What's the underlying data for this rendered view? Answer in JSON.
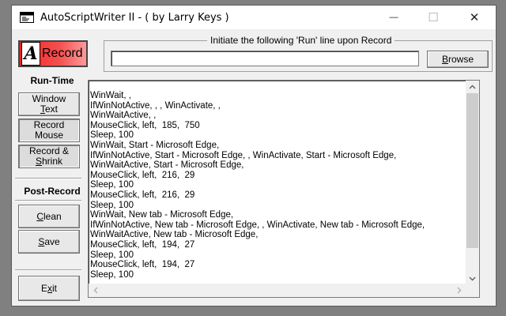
{
  "window": {
    "title": "AutoScriptWriter II - ( by Larry Keys )",
    "minimize_symbol": "—",
    "maximize_symbol": "☐",
    "close_symbol": "✕"
  },
  "record_button": {
    "icon_letter": "A",
    "label": "Record"
  },
  "run_group": {
    "legend": "Initiate the following 'Run' line upon Record",
    "input_value": "",
    "browse_label_first": "B",
    "browse_label_rest": "rowse"
  },
  "sidebar": {
    "runtime_label": "Run-Time",
    "window_text": {
      "line1": "Window",
      "line2_first": "T",
      "line2_rest": "ext"
    },
    "record_mouse": {
      "line1": "Record",
      "line2": "Mouse"
    },
    "record_shrink": {
      "line1": "Record &",
      "line2_first": "S",
      "line2_rest": "hrink"
    },
    "postrecord_label": "Post-Record",
    "clean": {
      "first": "C",
      "rest": "lean"
    },
    "save": {
      "first": "S",
      "rest": "ave"
    },
    "exit": {
      "first": "E",
      "mid": "x",
      "rest": "it"
    }
  },
  "script_text": "WinWait, ,\nIfWinNotActive, , , WinActivate, ,\nWinWaitActive, ,\nMouseClick, left,  185,  750\nSleep, 100\nWinWait, Start - Microsoft Edge,\nIfWinNotActive, Start - Microsoft Edge, , WinActivate, Start - Microsoft Edge,\nWinWaitActive, Start - Microsoft Edge,\nMouseClick, left,  216,  29\nSleep, 100\nMouseClick, left,  216,  29\nSleep, 100\nWinWait, New tab - Microsoft Edge,\nIfWinNotActive, New tab - Microsoft Edge, , WinActivate, New tab - Microsoft Edge,\nWinWaitActive, New tab - Microsoft Edge,\nMouseClick, left,  194,  27\nSleep, 100\nMouseClick, left,  194,  27\nSleep, 100",
  "colors": {
    "record_red": "#ff2020",
    "window_bg": "#f0f0f0",
    "desktop": "#808080"
  },
  "icons": {
    "app": "app-window-icon",
    "scroll_up": "chevron-up-icon",
    "scroll_down": "chevron-down-icon",
    "scroll_left": "chevron-left-icon",
    "scroll_right": "chevron-right-icon"
  }
}
